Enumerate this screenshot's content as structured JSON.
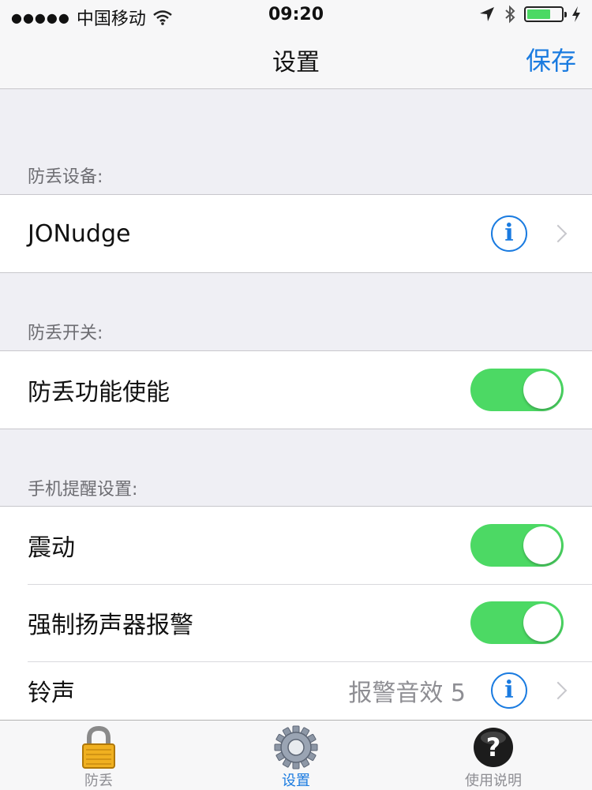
{
  "status_bar": {
    "signal": "●●●●●",
    "carrier": "中国移动",
    "time": "09:20"
  },
  "nav": {
    "title": "设置",
    "save_label": "保存"
  },
  "sections": {
    "device_header": "防丢设备:",
    "device_name": "JONudge",
    "switch_header": "防丢开关:",
    "anti_lost_label": "防丢功能使能",
    "alert_header": "手机提醒设置:",
    "vibrate_label": "震动",
    "speaker_label": "强制扬声器报警",
    "ringtone_label": "铃声",
    "ringtone_value": "报警音效 5"
  },
  "toggles": {
    "anti_lost_on": true,
    "vibrate_on": true,
    "speaker_on": true
  },
  "tabs": [
    {
      "label": "防丢",
      "icon": "lock-icon"
    },
    {
      "label": "设置",
      "icon": "gear-icon"
    },
    {
      "label": "使用说明",
      "icon": "help-icon"
    }
  ],
  "colors": {
    "accent": "#1a7be0",
    "toggle_on": "#4cd964",
    "battery": "#4cd964"
  },
  "battery_level": 0.7
}
